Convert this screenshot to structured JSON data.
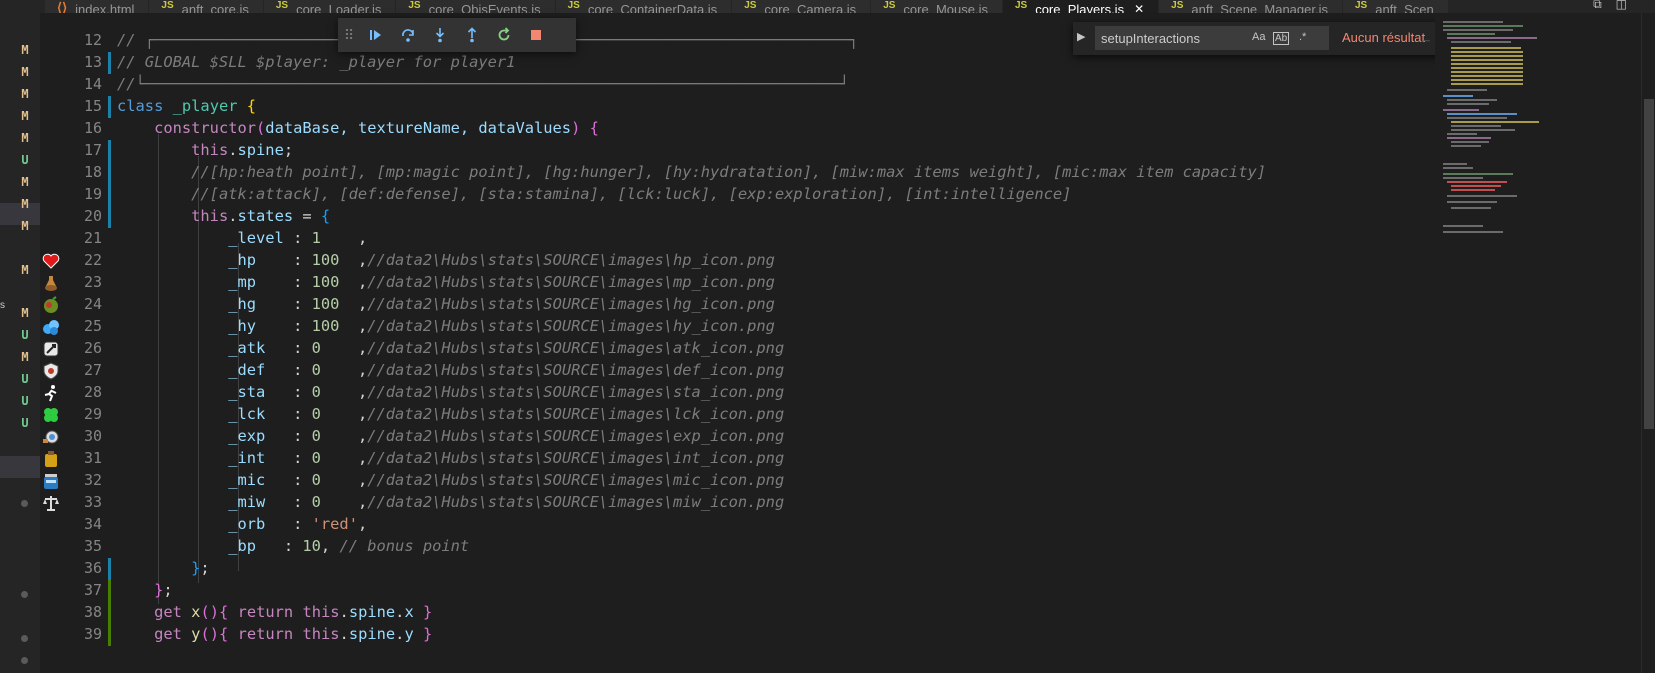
{
  "tabs": [
    {
      "icon": "html-file-icon",
      "label": "index.html",
      "active": false
    },
    {
      "icon": "js-file-icon",
      "label": "anft_core.js",
      "active": false
    },
    {
      "icon": "js-file-icon",
      "label": "core_Loader.js",
      "active": false
    },
    {
      "icon": "js-file-icon",
      "label": "core_ObjsEvents.js",
      "active": false
    },
    {
      "icon": "js-file-icon",
      "label": "core_ContainerData.js",
      "active": false
    },
    {
      "icon": "js-file-icon",
      "label": "core_Camera.js",
      "active": false
    },
    {
      "icon": "js-file-icon",
      "label": "core_Mouse.js",
      "active": false
    },
    {
      "icon": "js-file-icon",
      "label": "core_Players.js",
      "active": true
    },
    {
      "icon": "js-file-icon",
      "label": "anft_Scene_Manager.js",
      "active": false
    },
    {
      "icon": "js-file-icon",
      "label": "anft_Scen",
      "active": false
    }
  ],
  "tab_js_badge": "JS",
  "tab_close_glyph": "✕",
  "scm": {
    "marks": [
      "M",
      "M",
      "M",
      "M",
      "M",
      "U",
      "M",
      "M",
      "M",
      "M",
      "M",
      "U",
      "M",
      "U",
      "U",
      "U"
    ],
    "side_letter": "s"
  },
  "debug_toolbar": {
    "buttons": [
      "continue-icon",
      "step-over-icon",
      "step-into-icon",
      "step-out-icon",
      "restart-icon",
      "stop-icon"
    ]
  },
  "find": {
    "query": "setupInteractions",
    "match_case": "Aa",
    "whole_word": "Ab",
    "regex": ".*",
    "status": "Aucun résultat",
    "prev": "←",
    "next": "→",
    "close": "✕"
  },
  "editor": {
    "line_numbers": [
      "12",
      "13",
      "14",
      "15",
      "16",
      "17",
      "18",
      "19",
      "20",
      "21",
      "22",
      "23",
      "24",
      "25",
      "26",
      "27",
      "28",
      "29",
      "30",
      "31",
      "32",
      "33",
      "34",
      "35",
      "36",
      "37",
      "38",
      "39"
    ],
    "gutter_icons": [
      "heart-icon",
      "mana-potion-icon",
      "hunger-icon",
      "hydration-icon",
      "attack-icon",
      "defense-icon",
      "stamina-icon",
      "luck-clover-icon",
      "exploration-icon",
      "intelligence-icon",
      "capacity-icon",
      "weight-scale-icon"
    ],
    "lines": {
      "l12": "// ┌───────────────────────────────────────────────────────────────────────────┐",
      "l13": "// GLOBAL $SLL $player: _player for player1",
      "l14": "//└───────────────────────────────────────────────────────────────────────────┘",
      "l15_class": "class",
      "l15_name": "_player",
      "l16_ctor": "constructor",
      "l16_params": "dataBase, textureName, dataValues",
      "l17_this": "this",
      "l17_prop": "spine",
      "l18": "//[hp:heath point], [mp:magic point], [hg:hunger], [hy:hydratation], [miw:max items weight], [mic:max item capacity]",
      "l19": "//[atk:attack], [def:defense], [sta:stamina], [lck:luck], [exp:exploration], [int:intelligence]",
      "l20_prop": "states",
      "l21_key": "_level",
      "l21_val": "1",
      "stats": [
        {
          "key": "_hp",
          "val": "100",
          "comment": "//data2\\Hubs\\stats\\SOURCE\\images\\hp_icon.png"
        },
        {
          "key": "_mp",
          "val": "100",
          "comment": "//data2\\Hubs\\stats\\SOURCE\\images\\mp_icon.png"
        },
        {
          "key": "_hg",
          "val": "100",
          "comment": "//data2\\Hubs\\stats\\SOURCE\\images\\hg_icon.png"
        },
        {
          "key": "_hy",
          "val": "100",
          "comment": "//data2\\Hubs\\stats\\SOURCE\\images\\hy_icon.png"
        },
        {
          "key": "_atk",
          "val": "0",
          "comment": "//data2\\Hubs\\stats\\SOURCE\\images\\atk_icon.png"
        },
        {
          "key": "_def",
          "val": "0",
          "comment": "//data2\\Hubs\\stats\\SOURCE\\images\\def_icon.png"
        },
        {
          "key": "_sta",
          "val": "0",
          "comment": "//data2\\Hubs\\stats\\SOURCE\\images\\sta_icon.png"
        },
        {
          "key": "_lck",
          "val": "0",
          "comment": "//data2\\Hubs\\stats\\SOURCE\\images\\lck_icon.png"
        },
        {
          "key": "_exp",
          "val": "0",
          "comment": "//data2\\Hubs\\stats\\SOURCE\\images\\exp_icon.png"
        },
        {
          "key": "_int",
          "val": "0",
          "comment": "//data2\\Hubs\\stats\\SOURCE\\images\\int_icon.png"
        },
        {
          "key": "_mic",
          "val": "0",
          "comment": "//data2\\Hubs\\stats\\SOURCE\\images\\mic_icon.png"
        },
        {
          "key": "_miw",
          "val": "0",
          "comment": "//data2\\Hubs\\stats\\SOURCE\\images\\miw_icon.png"
        }
      ],
      "l34_key": "_orb",
      "l34_val": "'red'",
      "l35_key": "_bp",
      "l35_val": "10",
      "l35_comment": "// bonus point",
      "l38_get": "get",
      "l38_name": "x",
      "l38_return": "return",
      "l38_this": "this",
      "l38_spine": "spine",
      "l38_prop": "x",
      "l39_get": "get",
      "l39_name": "y",
      "l39_return": "return",
      "l39_this": "this",
      "l39_spine": "spine",
      "l39_prop": "y"
    }
  }
}
